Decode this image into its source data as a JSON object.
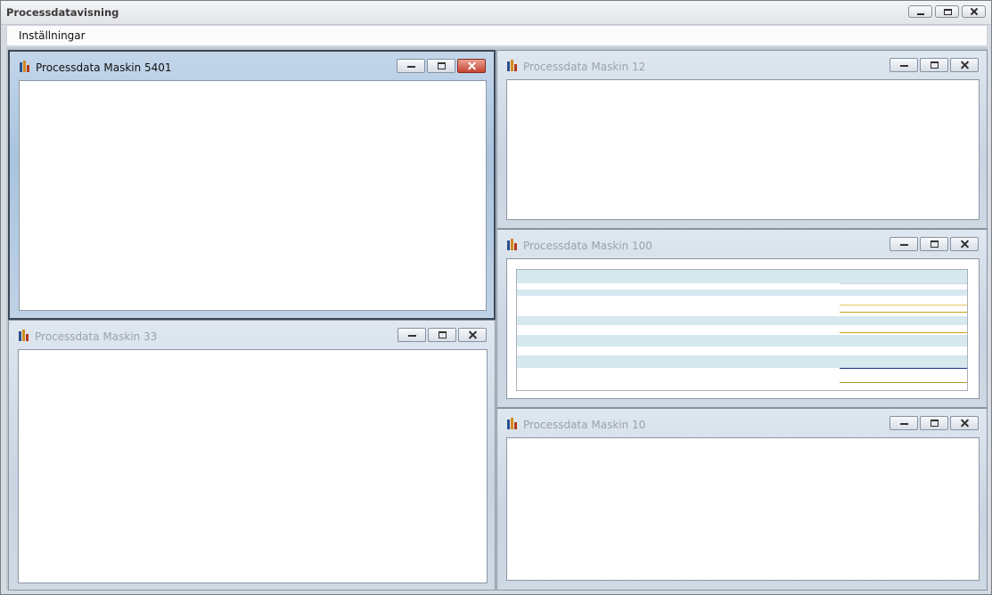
{
  "app": {
    "title": "Processdatavisning",
    "window_controls": [
      "minimize",
      "maximize",
      "close"
    ]
  },
  "menu": {
    "items": [
      "Inställningar"
    ]
  },
  "child_windows": [
    {
      "title": "Processdata Maskin 5401",
      "active": true
    },
    {
      "title": "Processdata Maskin 12",
      "active": false
    },
    {
      "title": "Processdata Maskin 100",
      "active": false
    },
    {
      "title": "Processdata Maskin 33",
      "active": false
    },
    {
      "title": "Processdata Maskin 10",
      "active": false
    }
  ],
  "colors": {
    "grid_band": "#d7e8ef",
    "line_gold": "#c9a21c",
    "line_olive": "#a79a2a",
    "line_navy": "#1c2a8a",
    "close_active": "#c6452f"
  },
  "icons": {
    "child_icon": "bar-chart-icon"
  }
}
